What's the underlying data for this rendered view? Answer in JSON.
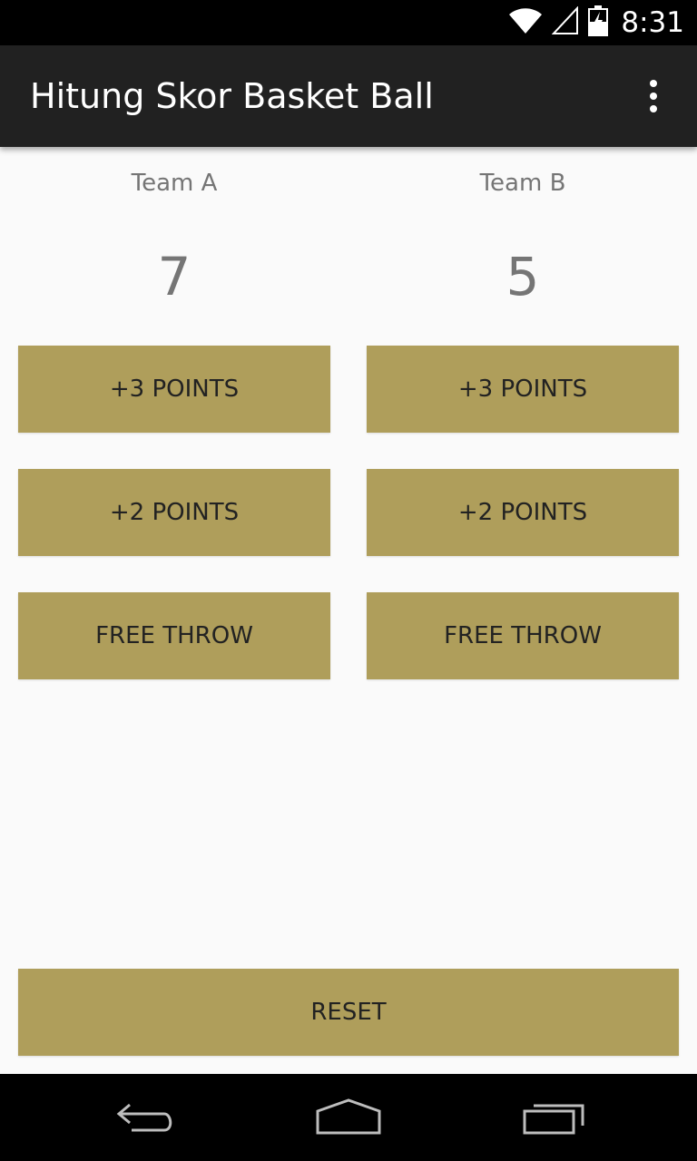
{
  "status_bar": {
    "time": "8:31",
    "icons": [
      "wifi-icon",
      "signal-icon",
      "battery-charging-icon"
    ]
  },
  "app_bar": {
    "title": "Hitung Skor Basket Ball",
    "menu_icon": "overflow-menu-icon"
  },
  "teams": [
    {
      "name": "Team A",
      "score": "7",
      "buttons": {
        "plus3": "+3 POINTS",
        "plus2": "+2 POINTS",
        "free_throw": "FREE THROW"
      }
    },
    {
      "name": "Team B",
      "score": "5",
      "buttons": {
        "plus3": "+3 POINTS",
        "plus2": "+2 POINTS",
        "free_throw": "FREE THROW"
      }
    }
  ],
  "reset_label": "RESET",
  "nav_bar": {
    "icons": [
      "back-icon",
      "home-icon",
      "recent-apps-icon"
    ]
  },
  "colors": {
    "button": "#af9e5b",
    "app_bar": "#212121",
    "background": "#fafafa",
    "label_text": "#757575"
  }
}
